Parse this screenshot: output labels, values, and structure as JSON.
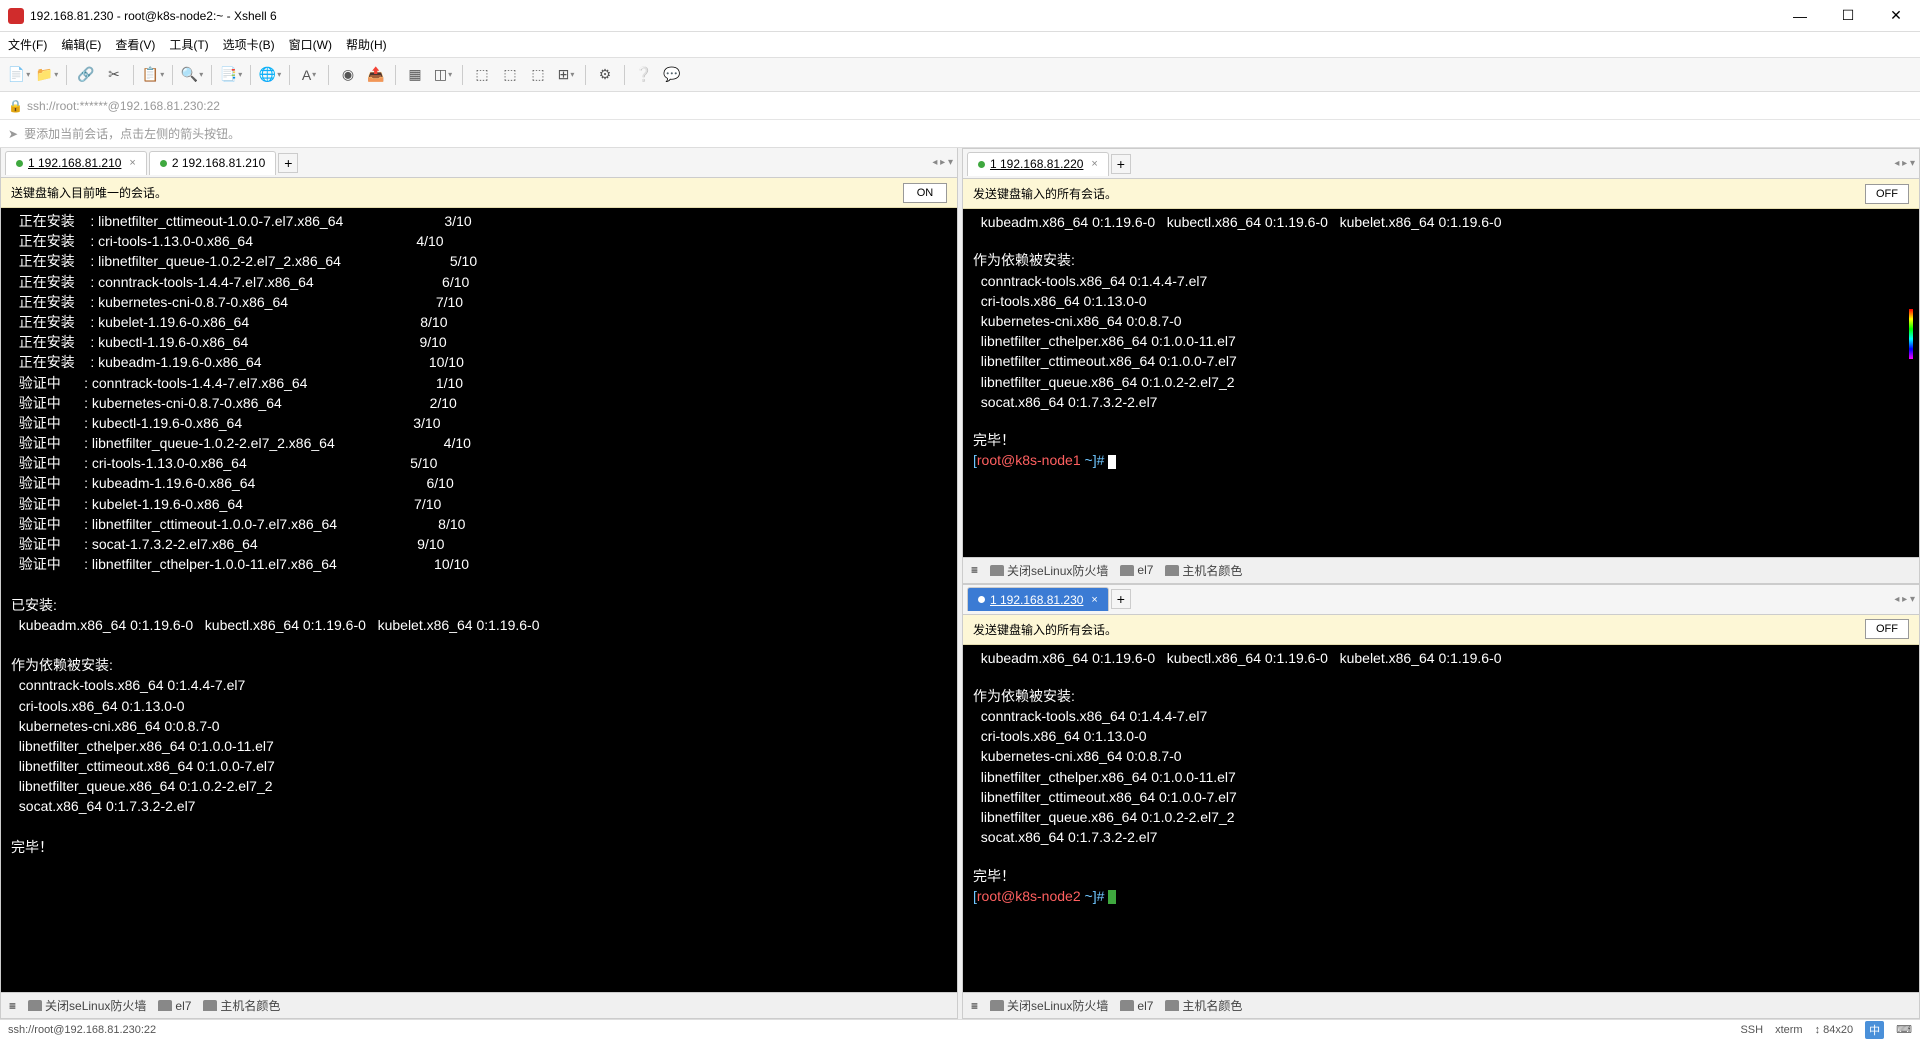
{
  "title": "192.168.81.230 - root@k8s-node2:~ - Xshell 6",
  "menu": [
    "文件(F)",
    "编辑(E)",
    "查看(V)",
    "工具(T)",
    "选项卡(B)",
    "窗口(W)",
    "帮助(H)"
  ],
  "address": "ssh://root:******@192.168.81.230:22",
  "hint": "要添加当前会话，点击左侧的箭头按钮。",
  "left": {
    "tabs": [
      {
        "label": "1 192.168.81.210",
        "active": true
      },
      {
        "label": "2 192.168.81.210",
        "active": false
      }
    ],
    "banner": "送键盘输入目前唯一的会话。",
    "toggle": "ON",
    "term": "  正在安装    : libnetfilter_cttimeout-1.0.0-7.el7.x86_64                          3/10\n  正在安装    : cri-tools-1.13.0-0.x86_64                                          4/10\n  正在安装    : libnetfilter_queue-1.0.2-2.el7_2.x86_64                            5/10\n  正在安装    : conntrack-tools-1.4.4-7.el7.x86_64                                 6/10\n  正在安装    : kubernetes-cni-0.8.7-0.x86_64                                      7/10\n  正在安装    : kubelet-1.19.6-0.x86_64                                            8/10\n  正在安装    : kubectl-1.19.6-0.x86_64                                            9/10\n  正在安装    : kubeadm-1.19.6-0.x86_64                                           10/10\n  验证中      : conntrack-tools-1.4.4-7.el7.x86_64                                 1/10\n  验证中      : kubernetes-cni-0.8.7-0.x86_64                                      2/10\n  验证中      : kubectl-1.19.6-0.x86_64                                            3/10\n  验证中      : libnetfilter_queue-1.0.2-2.el7_2.x86_64                            4/10\n  验证中      : cri-tools-1.13.0-0.x86_64                                          5/10\n  验证中      : kubeadm-1.19.6-0.x86_64                                            6/10\n  验证中      : kubelet-1.19.6-0.x86_64                                            7/10\n  验证中      : libnetfilter_cttimeout-1.0.0-7.el7.x86_64                          8/10\n  验证中      : socat-1.7.3.2-2.el7.x86_64                                         9/10\n  验证中      : libnetfilter_cthelper-1.0.0-11.el7.x86_64                         10/10\n\n已安装:\n  kubeadm.x86_64 0:1.19.6-0   kubectl.x86_64 0:1.19.6-0   kubelet.x86_64 0:1.19.6-0\n\n作为依赖被安装:\n  conntrack-tools.x86_64 0:1.4.4-7.el7\n  cri-tools.x86_64 0:1.13.0-0\n  kubernetes-cni.x86_64 0:0.8.7-0\n  libnetfilter_cthelper.x86_64 0:1.0.0-11.el7\n  libnetfilter_cttimeout.x86_64 0:1.0.0-7.el7\n  libnetfilter_queue.x86_64 0:1.0.2-2.el7_2\n  socat.x86_64 0:1.7.3.2-2.el7\n\n完毕！",
    "footer": [
      "关闭seLinux防火墙",
      "el7",
      "主机名颜色"
    ]
  },
  "rt": {
    "tab": "1 192.168.81.220",
    "banner": "发送键盘输入的所有会话。",
    "toggle": "OFF",
    "pkgs": "  kubeadm.x86_64 0:1.19.6-0   kubectl.x86_64 0:1.19.6-0   kubelet.x86_64 0:1.19.6-0",
    "depHdr": "作为依赖被安装:",
    "deps": "  conntrack-tools.x86_64 0:1.4.4-7.el7\n  cri-tools.x86_64 0:1.13.0-0\n  kubernetes-cni.x86_64 0:0.8.7-0\n  libnetfilter_cthelper.x86_64 0:1.0.0-11.el7\n  libnetfilter_cttimeout.x86_64 0:1.0.0-7.el7\n  libnetfilter_queue.x86_64 0:1.0.2-2.el7_2\n  socat.x86_64 0:1.7.3.2-2.el7",
    "done": "完毕！",
    "p1": "[",
    "pu": "root@",
    "ph": "k8s-node1",
    "pp": " ~",
    "pe": "]# ",
    "footer": [
      "关闭seLinux防火墙",
      "el7",
      "主机名颜色"
    ]
  },
  "rb": {
    "tab": "1 192.168.81.230",
    "banner": "发送键盘输入的所有会话。",
    "toggle": "OFF",
    "pkgs": "  kubeadm.x86_64 0:1.19.6-0   kubectl.x86_64 0:1.19.6-0   kubelet.x86_64 0:1.19.6-0",
    "depHdr": "作为依赖被安装:",
    "deps": "  conntrack-tools.x86_64 0:1.4.4-7.el7\n  cri-tools.x86_64 0:1.13.0-0\n  kubernetes-cni.x86_64 0:0.8.7-0\n  libnetfilter_cthelper.x86_64 0:1.0.0-11.el7\n  libnetfilter_cttimeout.x86_64 0:1.0.0-7.el7\n  libnetfilter_queue.x86_64 0:1.0.2-2.el7_2\n  socat.x86_64 0:1.7.3.2-2.el7",
    "done": "完毕！",
    "p1": "[",
    "pu": "root@",
    "ph": "k8s-node2",
    "pp": " ~",
    "pe": "]# ",
    "footer": [
      "关闭seLinux防火墙",
      "el7",
      "主机名颜色"
    ]
  },
  "status": {
    "left": "ssh://root@192.168.81.230:22",
    "right": [
      "SSH",
      "xterm",
      "↕ 84x20",
      "中"
    ]
  }
}
